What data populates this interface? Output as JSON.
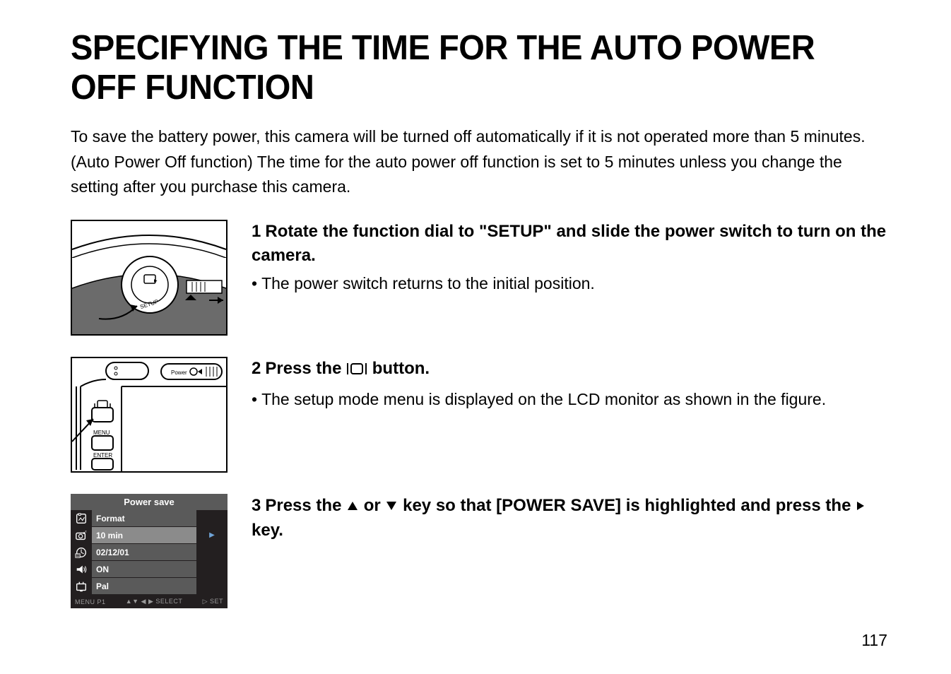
{
  "title": "SPECIFYING THE TIME FOR THE AUTO POWER OFF FUNCTION",
  "intro": "To save the battery power, this camera will be turned off automatically if it is not operated more than 5 minutes. (Auto Power Off function) The time for the auto power off function is set to 5 minutes unless you change the setting after you purchase this camera.",
  "step1": {
    "num": "1",
    "heading": "Rotate the function dial to \"SETUP\" and slide the power switch to turn on the camera.",
    "bullet": "The power switch returns to the initial position."
  },
  "step2": {
    "num": "2",
    "heading_pre": "Press the ",
    "heading_post": " button.",
    "bullet": "The setup mode menu is displayed on the LCD monitor as shown in the figure.",
    "back_labels": {
      "power": "Power",
      "menu": "MENU",
      "enter": "ENTER"
    }
  },
  "step3": {
    "num": "3",
    "heading_pre": "Press the ",
    "heading_mid": " or ",
    "heading_mid2": "  key so that [POWER SAVE] is highlighted and press the ",
    "heading_post": " key."
  },
  "menu": {
    "title": "Power save",
    "rows": [
      {
        "icon": "format",
        "label": "Format",
        "value": ""
      },
      {
        "icon": "powersave",
        "label": "10 min",
        "value": "▶",
        "highlight": true
      },
      {
        "icon": "date",
        "label": "02/12/01",
        "value": ""
      },
      {
        "icon": "sound",
        "label": "ON",
        "value": ""
      },
      {
        "icon": "video",
        "label": "Pal",
        "value": ""
      }
    ],
    "footer_left": "MENU P1",
    "footer_mid": "▲▼ ◀ ▶ SELECT",
    "footer_right": "▷ SET"
  },
  "ill1_label": "SETUP",
  "pagenum": "117"
}
